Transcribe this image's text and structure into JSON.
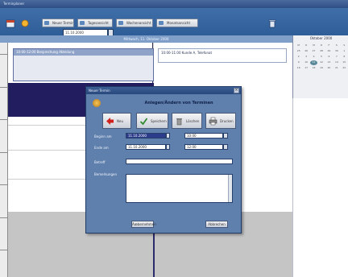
{
  "window": {
    "title": "Terminplaner"
  },
  "toolbar": {
    "buttons": [
      {
        "label": "Neuer Termin",
        "icon": "new-appointment-icon"
      },
      {
        "label": "Tagesansicht",
        "icon": "day-view-icon"
      },
      {
        "label": "Wochenansicht",
        "icon": "week-view-icon"
      },
      {
        "label": "Monatsansicht",
        "icon": "month-view-icon"
      }
    ],
    "date_label": "Datum",
    "date_value": "11.10.2000"
  },
  "schedule": {
    "header": "Mittwoch, 11. Oktober 2000",
    "events": [
      {
        "text": "10:00-12:00 Besprechung Abteilung"
      },
      {
        "text": "10:00-11:00 Kunde A, Telefonat"
      }
    ]
  },
  "calendar": {
    "title": "Oktober 2000",
    "weekdays": [
      "M",
      "D",
      "M",
      "D",
      "F",
      "S",
      "S"
    ],
    "days": [
      "25",
      "26",
      "27",
      "28",
      "29",
      "30",
      "1",
      "2",
      "3",
      "4",
      "5",
      "6",
      "7",
      "8",
      "9",
      "10",
      "11",
      "12",
      "13",
      "14",
      "15",
      "16",
      "17",
      "18",
      "19",
      "20",
      "21",
      "22"
    ],
    "selected_index": 16
  },
  "dialog": {
    "title": "Neuer Termin",
    "heading": "Anlegen/Ändern von Terminen",
    "buttons": [
      {
        "label": "Neu",
        "icon": "red-arrow-icon",
        "color": "#d0221c"
      },
      {
        "label": "Speichern",
        "icon": "checkmark-icon",
        "color": "#2f8a2f"
      },
      {
        "label": "Löschen",
        "icon": "trash-icon",
        "color": "#7a7a7a"
      },
      {
        "label": "Drucken",
        "icon": "printer-icon",
        "color": "#5a5a5a"
      }
    ],
    "fields": {
      "start_label": "Beginn am",
      "start_date": "11.10.2000",
      "start_time": "10:00",
      "end_label": "Ende am",
      "end_date": "11.10.2000",
      "end_time": "12:00",
      "subject_label": "Betreff",
      "subject_value": "",
      "notes_label": "Bemerkungen",
      "notes_value": ""
    },
    "footer": {
      "ok_label": "Ãœbernehmen",
      "cancel_label": "Abbrechen"
    }
  }
}
